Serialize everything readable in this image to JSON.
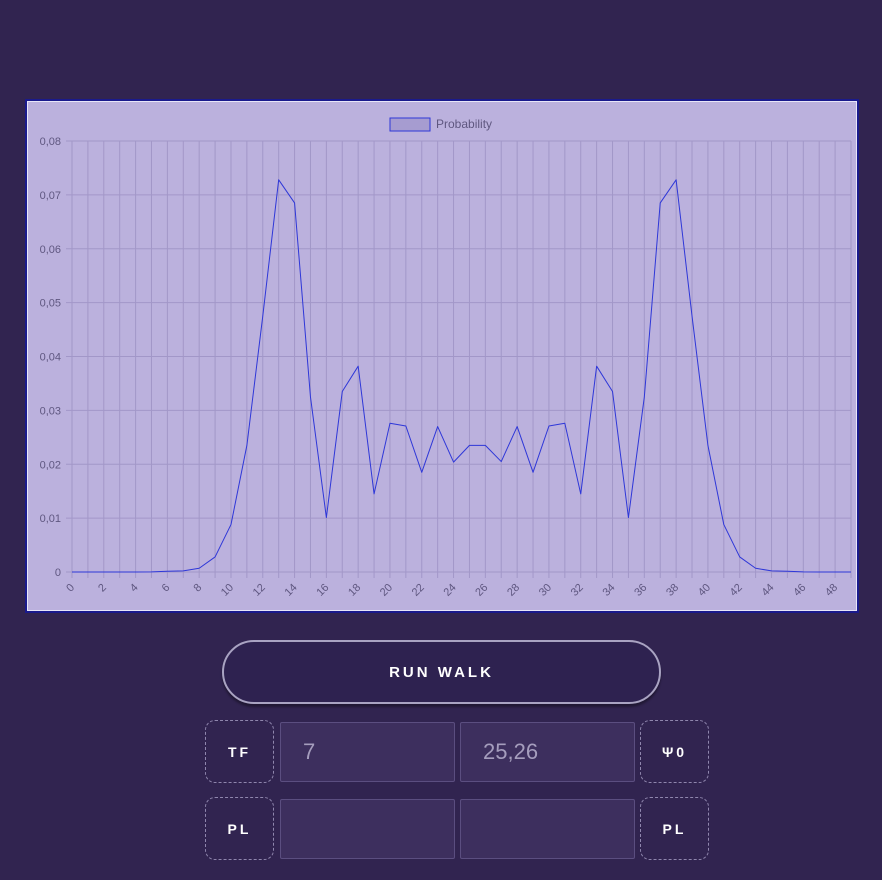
{
  "chart_data": {
    "type": "line",
    "legend": {
      "label": "Probability",
      "position": "top-center"
    },
    "x": [
      0,
      1,
      2,
      3,
      4,
      5,
      6,
      7,
      8,
      9,
      10,
      11,
      12,
      13,
      14,
      15,
      16,
      17,
      18,
      19,
      20,
      21,
      22,
      23,
      24,
      25,
      26,
      27,
      28,
      29,
      30,
      31,
      32,
      33,
      34,
      35,
      36,
      37,
      38,
      39,
      40,
      41,
      42,
      43,
      44,
      45,
      46,
      47,
      48,
      49
    ],
    "x_tick_labels": [
      "0",
      "2",
      "4",
      "6",
      "8",
      "10",
      "12",
      "14",
      "16",
      "18",
      "20",
      "22",
      "24",
      "26",
      "28",
      "30",
      "32",
      "34",
      "36",
      "38",
      "40",
      "42",
      "44",
      "46",
      "48"
    ],
    "series": [
      {
        "name": "Probability",
        "color": "#2e37d8",
        "values": [
          0,
          0,
          0,
          0,
          0,
          2e-05,
          0.00015,
          0.0002,
          0.0007,
          0.0028,
          0.0088,
          0.0235,
          0.0475,
          0.0728,
          0.0685,
          0.0325,
          0.0101,
          0.0335,
          0.0382,
          0.0145,
          0.0276,
          0.0271,
          0.0185,
          0.027,
          0.0204,
          0.0235,
          0.0235,
          0.0205,
          0.027,
          0.0185,
          0.0271,
          0.0276,
          0.0145,
          0.0382,
          0.0335,
          0.0101,
          0.0325,
          0.0685,
          0.0728,
          0.0475,
          0.0235,
          0.0088,
          0.0028,
          0.0007,
          0.0002,
          0.00015,
          2e-05,
          0,
          0,
          0
        ]
      }
    ],
    "y_ticks": [
      "0",
      "0,01",
      "0,02",
      "0,03",
      "0,04",
      "0,05",
      "0,06",
      "0,07",
      "0,08"
    ],
    "ylim": [
      0,
      0.08
    ],
    "grid": true
  },
  "controls": {
    "run_label": "RUN WALK",
    "row1": {
      "left_tag": "TF",
      "field1_value": "7",
      "field2_value": "25,26",
      "right_tag": "Ψ0"
    },
    "row2": {
      "left_tag": "PL",
      "field1_value": "",
      "field2_value": "",
      "right_tag": "PL"
    }
  },
  "colors": {
    "background": "#312450",
    "chart_background": "#bbb1dd",
    "line": "#2e37d8",
    "field_background": "#3d2f5e"
  }
}
